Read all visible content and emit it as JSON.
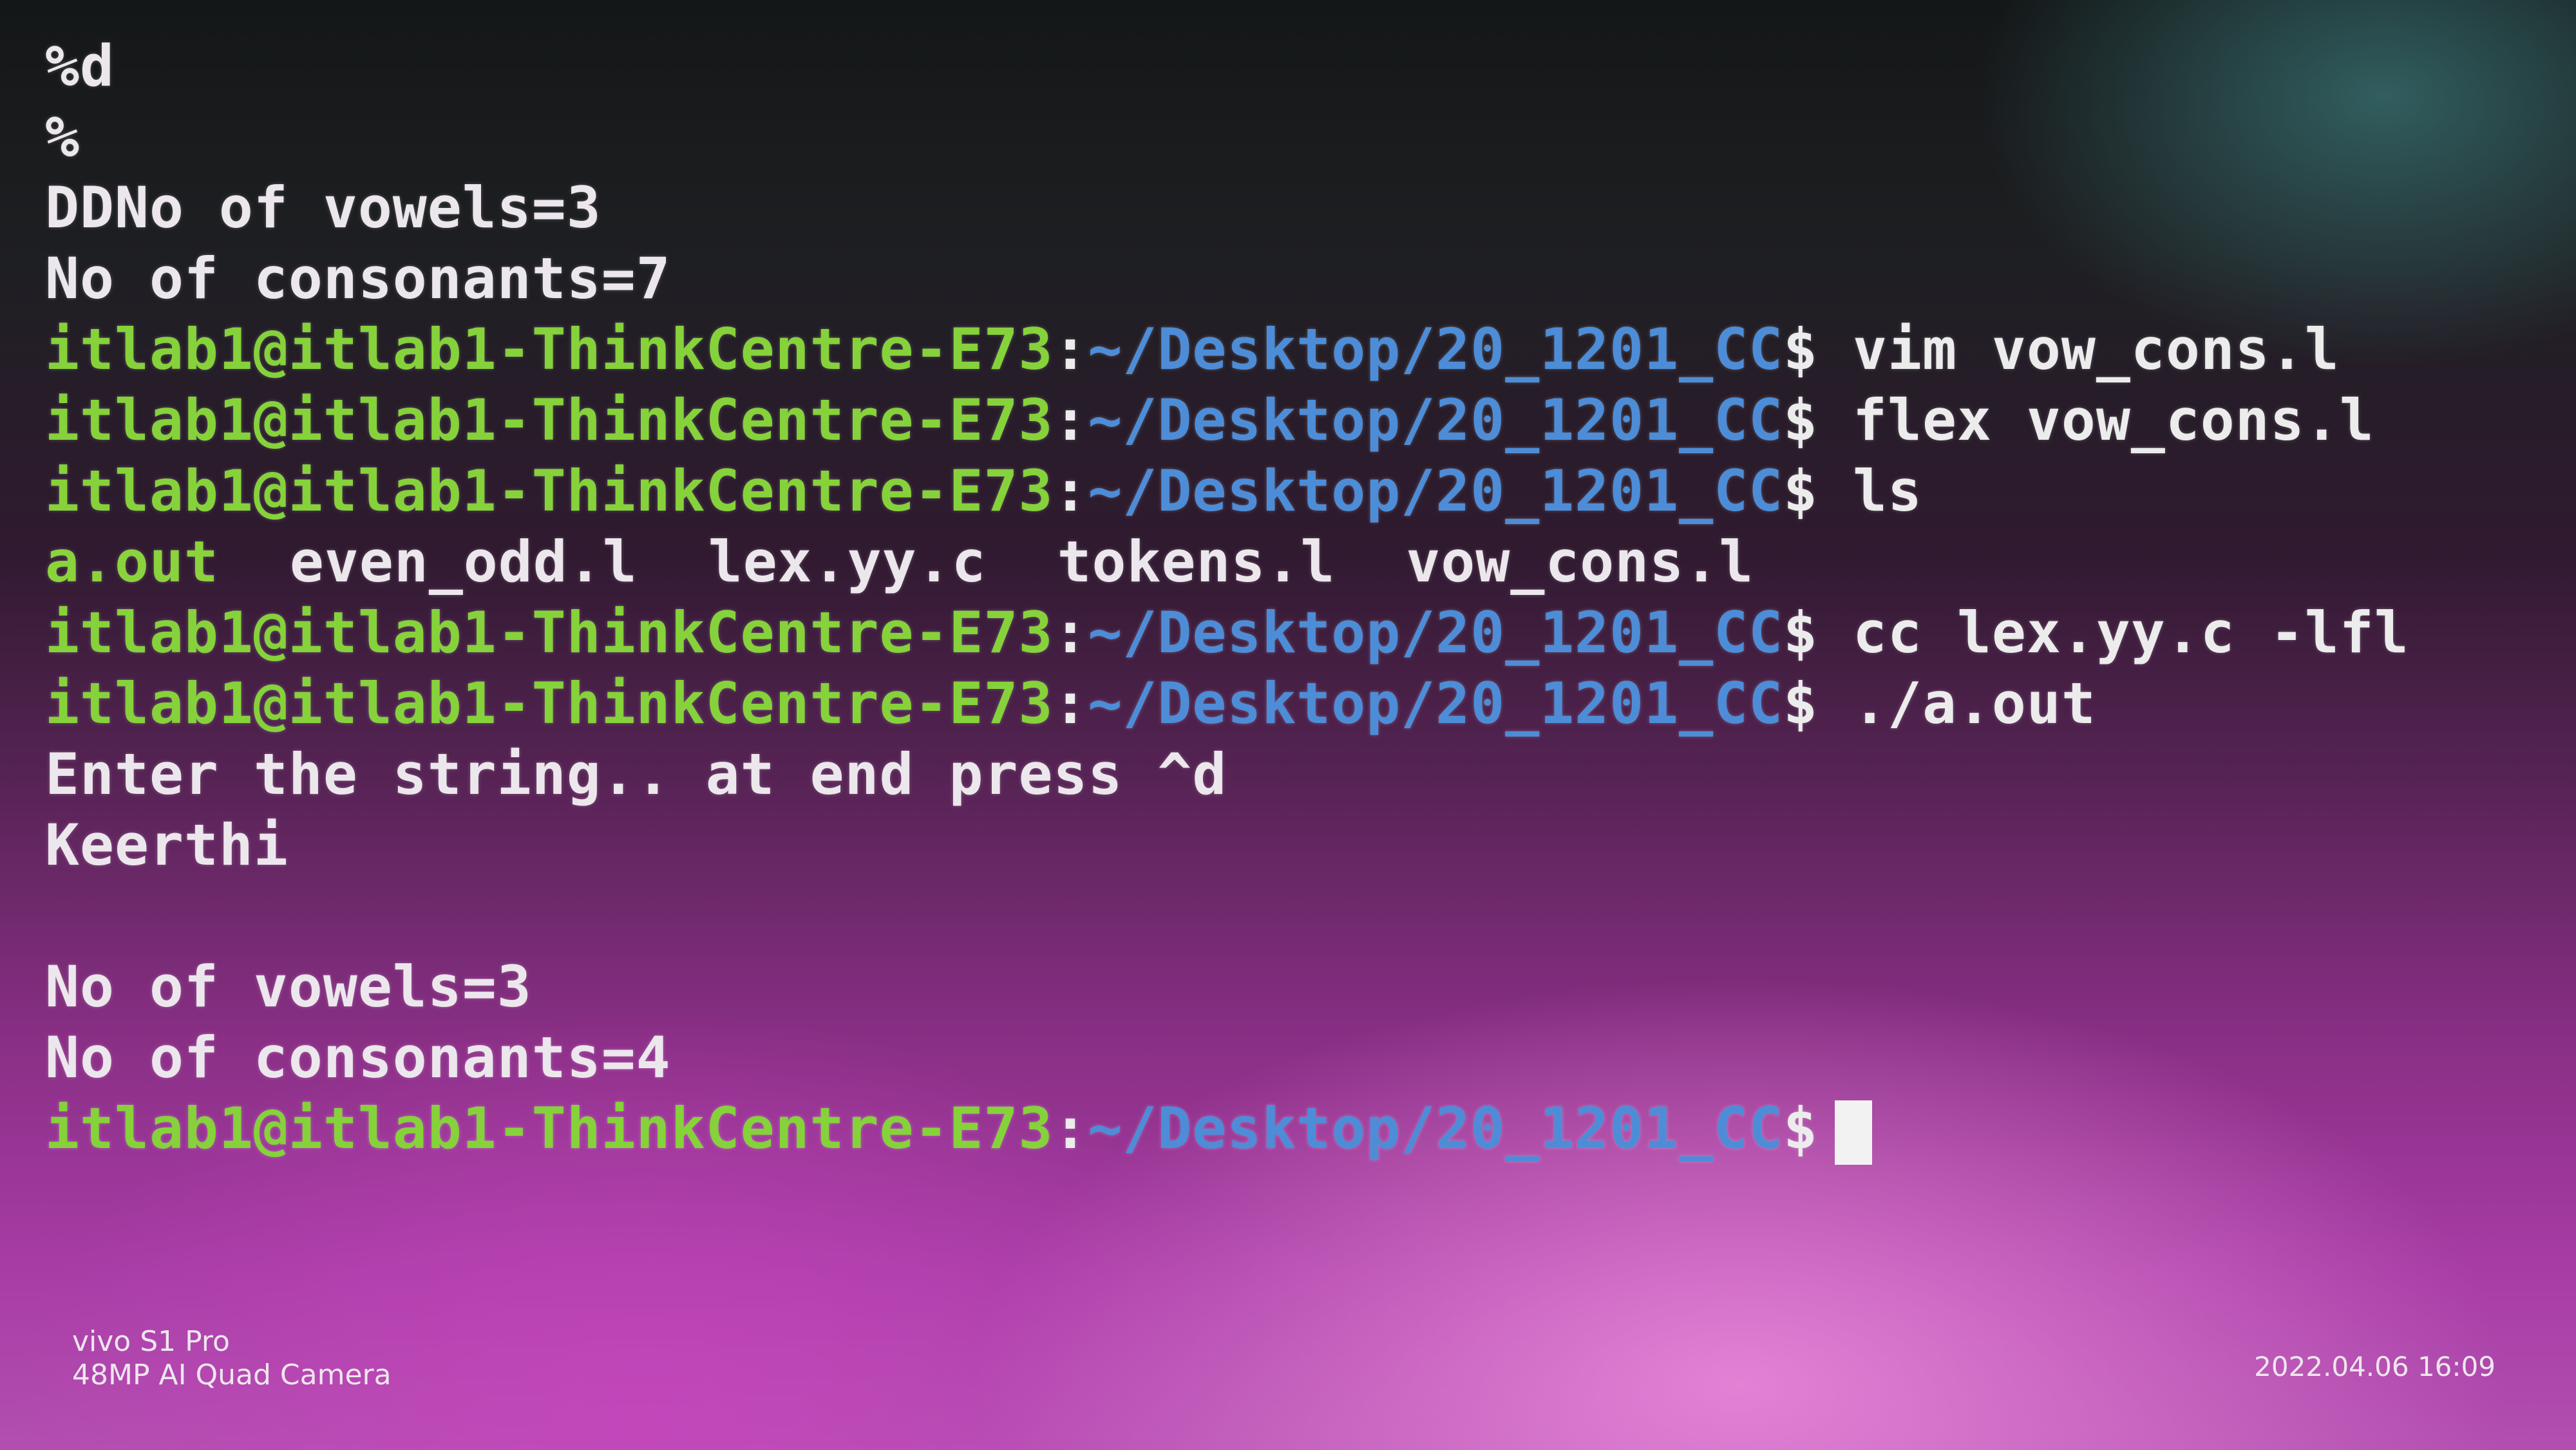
{
  "terminal": {
    "out1": "%d",
    "out2": "%",
    "out3": "DDNo of vowels=3",
    "out4": "No of consonants=7",
    "prompt": {
      "user": "itlab1@itlab1-ThinkCentre-E73",
      "sep": ":",
      "path": "~/Desktop/20_1201_CC",
      "dollar": "$"
    },
    "cmd1": " vim vow_cons.l",
    "cmd2": " flex vow_cons.l",
    "cmd3": " ls",
    "ls_files": [
      "a.out",
      "even_odd.l",
      "lex.yy.c",
      "tokens.l",
      "vow_cons.l"
    ],
    "cmd4": " cc lex.yy.c -lfl",
    "cmd5": " ./a.out",
    "out5": "Enter the string.. at end press ^d",
    "out6": "Keerthi",
    "out7": "No of vowels=3",
    "out8": "No of consonants=4"
  },
  "overlay": {
    "device": "vivo S1 Pro",
    "camera": "48MP AI Quad Camera",
    "timestamp": "2022.04.06 16:09"
  },
  "colors": {
    "prompt_user": "#86d23a",
    "prompt_path": "#4d8dd8",
    "text": "#ece7ec"
  }
}
